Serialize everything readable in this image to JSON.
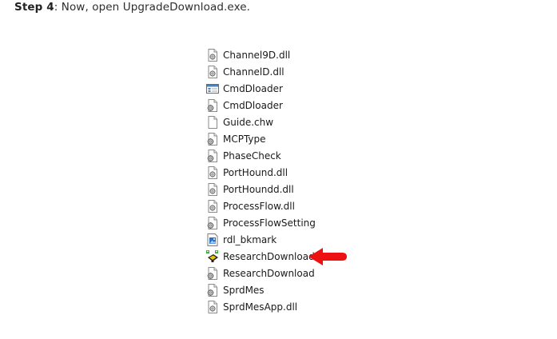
{
  "instruction": {
    "step_label": "Step 4",
    "text": ": Now, open UpgradeDownload.exe."
  },
  "files": [
    {
      "name": "Channel9D.dll",
      "icon": "dll-gear-icon"
    },
    {
      "name": "ChannelD.dll",
      "icon": "dll-gear-icon"
    },
    {
      "name": "CmdDloader",
      "icon": "application-window-icon"
    },
    {
      "name": "CmdDloader",
      "icon": "config-gear-icon"
    },
    {
      "name": "Guide.chw",
      "icon": "blank-file-icon"
    },
    {
      "name": "MCPType",
      "icon": "config-gear-icon"
    },
    {
      "name": "PhaseCheck",
      "icon": "config-gear-icon"
    },
    {
      "name": "PortHound.dll",
      "icon": "dll-gear-icon"
    },
    {
      "name": "PortHoundd.dll",
      "icon": "dll-gear-icon"
    },
    {
      "name": "ProcessFlow.dll",
      "icon": "dll-gear-icon"
    },
    {
      "name": "ProcessFlowSetting",
      "icon": "config-gear-icon"
    },
    {
      "name": "rdl_bkmark",
      "icon": "image-file-icon"
    },
    {
      "name": "ResearchDownload",
      "icon": "research-download-exe-icon"
    },
    {
      "name": "ResearchDownload",
      "icon": "config-gear-icon"
    },
    {
      "name": "SprdMes",
      "icon": "config-gear-icon"
    },
    {
      "name": "SprdMesApp.dll",
      "icon": "dll-gear-icon"
    }
  ],
  "colors": {
    "arrow": "#ee1111",
    "text": "#1a1a1a"
  }
}
